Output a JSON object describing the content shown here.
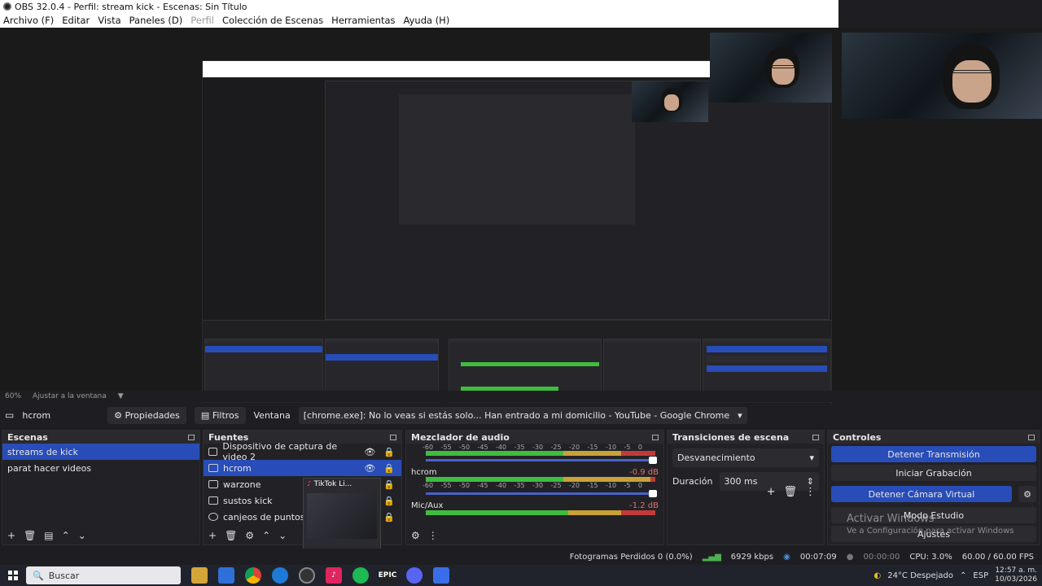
{
  "window": {
    "title": "OBS 32.0.4 - Perfil: stream kick - Escenas: Sin Título"
  },
  "menu": [
    "Archivo (F)",
    "Editar",
    "Vista",
    "Paneles (D)",
    "Perfil",
    "Colección de Escenas",
    "Herramientas",
    "Ayuda (H)"
  ],
  "zoom": {
    "level": "60%",
    "fit_label": "Ajustar a la ventana"
  },
  "source_toolbar": {
    "selected_source": "hcrom",
    "properties_label": "Propiedades",
    "filters_label": "Filtros",
    "window_label": "Ventana",
    "window_value": "[chrome.exe]: No lo veas si estás solo... Han entrado a mi domicilio - YouTube - Google Chrome"
  },
  "scenes": {
    "title": "Escenas",
    "items": [
      {
        "label": "streams de kick",
        "selected": true
      },
      {
        "label": "parat hacer videos",
        "selected": false
      }
    ]
  },
  "sources": {
    "title": "Fuentes",
    "items": [
      {
        "label": "Dispositivo de captura de video 2",
        "icon": "camera-icon",
        "selected": false
      },
      {
        "label": "hcrom",
        "icon": "window-icon",
        "selected": true
      },
      {
        "label": "warzone",
        "icon": "window-icon",
        "selected": false
      },
      {
        "label": "sustos kick",
        "icon": "window-icon",
        "selected": false
      },
      {
        "label": "canjeos de puntos",
        "icon": "globe-icon",
        "selected": false
      }
    ],
    "drag_preview_label": "TikTok Li..."
  },
  "mixer": {
    "title": "Mezclador de audio",
    "ticks": [
      "-60",
      "-55",
      "-50",
      "-45",
      "-40",
      "-35",
      "-30",
      "-25",
      "-20",
      "-15",
      "-10",
      "-5",
      "0"
    ],
    "channels": [
      {
        "name": "hcrom",
        "db": "-0.9 dB",
        "level": 0.96
      },
      {
        "name": "Mic/Aux",
        "db": "-1.2 dB",
        "level": 0.62
      }
    ]
  },
  "transitions": {
    "title": "Transiciones de escena",
    "selected": "Desvanecimiento",
    "duration_label": "Duración",
    "duration_value": "300 ms"
  },
  "controls": {
    "title": "Controles",
    "buttons": [
      {
        "label": "Detener Transmisión",
        "active": true
      },
      {
        "label": "Iniciar Grabación",
        "active": false
      },
      {
        "label": "Detener Cámara Virtual",
        "active": true
      },
      {
        "label": "Modo Estudio",
        "active": false
      },
      {
        "label": "Ajustes",
        "active": false
      }
    ]
  },
  "status": {
    "dropped_frames": "Fotogramas Perdidos 0 (0.0%)",
    "bitrate": "6929 kbps",
    "stream_time": "00:07:09",
    "record_time": "00:00:00",
    "cpu": "CPU: 3.0%",
    "fps": "60.00 / 60.00 FPS"
  },
  "activate_windows": {
    "title": "Activar Windows",
    "subtitle": "Ve a Configuración para activar Windows"
  },
  "taskbar": {
    "search_placeholder": "Buscar",
    "weather": "24°C  Despejado",
    "lang": "ESP",
    "time": "12:57 a. m.",
    "date": "10/03/2026"
  },
  "colors": {
    "accent": "#284cb8",
    "meter_green": "#3fbd3f",
    "meter_yellow": "#c8a236",
    "meter_red": "#c23a3a"
  }
}
